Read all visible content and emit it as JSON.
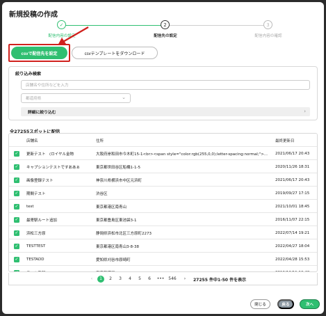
{
  "dialog": {
    "title": "新規投稿の作成"
  },
  "steps": [
    {
      "label": "配信内容の設定",
      "number": "",
      "state": "done"
    },
    {
      "label": "配信先の設定",
      "number": "2",
      "state": "current"
    },
    {
      "label": "配信内容の確認",
      "number": "3",
      "state": "pending"
    }
  ],
  "actions": {
    "csv_set_label": "csvで配信先を設定",
    "csv_template_label": "csvテンプレートをダウンロード"
  },
  "filter": {
    "title": "絞り込み検索",
    "search_placeholder": "店舗名や住所などを入力",
    "prefecture_placeholder": "都道府県",
    "detail_label": "詳細に絞り込む"
  },
  "table": {
    "count_label": "全27255スポットに配信",
    "columns": [
      "店舗名",
      "住所",
      "最終更新日"
    ],
    "rows": [
      {
        "name": "更新テスト　(ロイヤル金物",
        "address": "大阪府岸和田市今木町15-1<br><span style=\"color:rgb(255,0,0);letter-spacing:normal;\">...",
        "date": "2021/06/17 20:43"
      },
      {
        "name": "キャプションテストですああぁ",
        "address": "東京都世田谷区船橋1-1-5",
        "date": "2020/11/26 18:31"
      },
      {
        "name": "画像登録テスト",
        "address": "神奈川県横浜市中区元浜町",
        "date": "2021/06/17 20:43"
      },
      {
        "name": "期間テスト",
        "address": "渋谷区",
        "date": "2019/09/27 17:15"
      },
      {
        "name": "test",
        "address": "東京都港区南青山",
        "date": "2021/10/01 18:45"
      },
      {
        "name": "最寄駅ルート追加",
        "address": "東京都豊島区東池袋3-1",
        "date": "2016/11/07 22:15"
      },
      {
        "name": "浜松三方原",
        "address": "静岡県浜松市北区三方原町2273",
        "date": "2022/07/14 19:21"
      },
      {
        "name": "TESTTEST",
        "address": "東京都港区南青山3-8-38",
        "date": "2022/04/27 18:04"
      },
      {
        "name": "TESTADD",
        "address": "愛知県刈谷市原崎町",
        "date": "2022/04/28 15:53"
      },
      {
        "name": "テスト登録",
        "address": "東京都港区",
        "date": "2019/12/11 10:48"
      }
    ]
  },
  "pagination": {
    "pages": [
      "1",
      "2",
      "3",
      "4",
      "5",
      "6",
      "•••",
      "546"
    ],
    "prev": "‹",
    "next": "›",
    "info": "27255 件中1-50 件を表示",
    "current": "1"
  },
  "footer": {
    "close_label": "閉じる",
    "back_label": "戻る",
    "next_label": "次へ"
  },
  "colors": {
    "accent": "#2fbf71",
    "highlight": "#d0211d"
  }
}
